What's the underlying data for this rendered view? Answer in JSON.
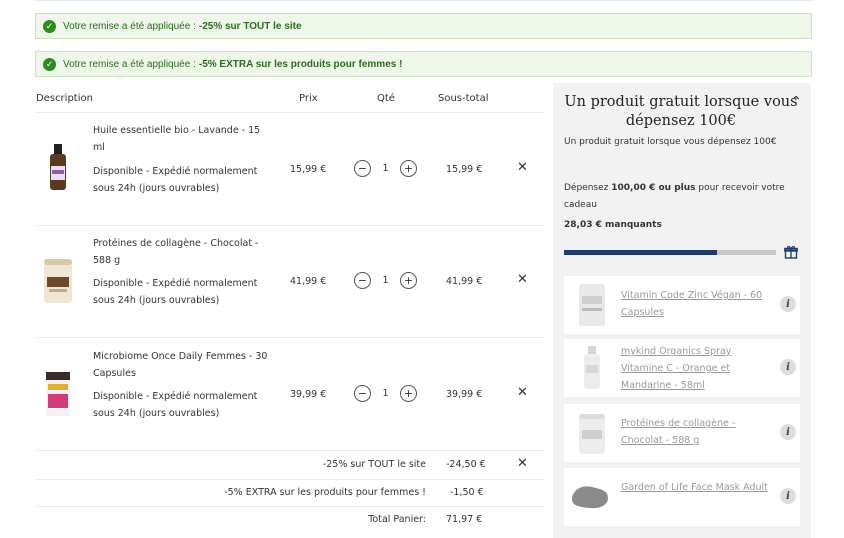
{
  "banners": [
    {
      "text": "Votre remise a été appliquée : ",
      "bold": "-25% sur TOUT le site"
    },
    {
      "text": "Votre remise a été appliquée : ",
      "bold": "-5% EXTRA sur les produits pour femmes !"
    }
  ],
  "table": {
    "headers": {
      "description": "Description",
      "price": "Prix",
      "qty": "Qté",
      "subtotal": "Sous-total"
    },
    "items": [
      {
        "name": "Huile essentielle bio - Lavande - 15 ml",
        "availability": "Disponible  -  Expédié normalement sous 24h (jours ouvrables)",
        "price": "15,99 €",
        "qty": "1",
        "subtotal": "15,99 €"
      },
      {
        "name": "Protéines de collagène - Chocolat - 588 g",
        "availability": "Disponible  -  Expédié normalement sous 24h (jours ouvrables)",
        "price": "41,99 €",
        "qty": "1",
        "subtotal": "41,99 €"
      },
      {
        "name": "Microbiome Once Daily Femmes - 30 Capsules",
        "availability": "Disponible  -  Expédié normalement sous 24h (jours ouvrables)",
        "price": "39,99 €",
        "qty": "1",
        "subtotal": "39,99 €"
      }
    ],
    "summary": [
      {
        "label": "-25% sur TOUT le site",
        "value": "-24,50 €"
      },
      {
        "label": "-5% EXTRA sur les produits pour femmes !",
        "value": "-1,50 €"
      },
      {
        "label": "Total Panier:",
        "value": "71,97 €"
      }
    ]
  },
  "panel": {
    "title": "Un produit gratuit lorsque vous dépensez 100€",
    "subtitle": "Un produit gratuit lorsque vous dépensez 100€",
    "spend_prefix": "Dépensez ",
    "spend_bold": "100,00 € ou plus",
    "spend_suffix": " pour recevoir votre cadeau",
    "missing": "28,03 € manquants",
    "progress": 0.72,
    "gifts": [
      {
        "name": "Vitamin Code Zinc Végan - 60 Capsules"
      },
      {
        "name": "mykind Organics Spray Vitamine C - Orange et Mandarine - 58ml"
      },
      {
        "name": "Protéines de collagène - Chocolat - 588 g"
      },
      {
        "name": "Garden of Life Face Mask Adult"
      }
    ]
  },
  "colors": {
    "banner_bg": "#eef7ea",
    "check_green": "#2f8a22",
    "progress_fill": "#1f3d6e",
    "panel_bg": "#f2f2f2"
  }
}
